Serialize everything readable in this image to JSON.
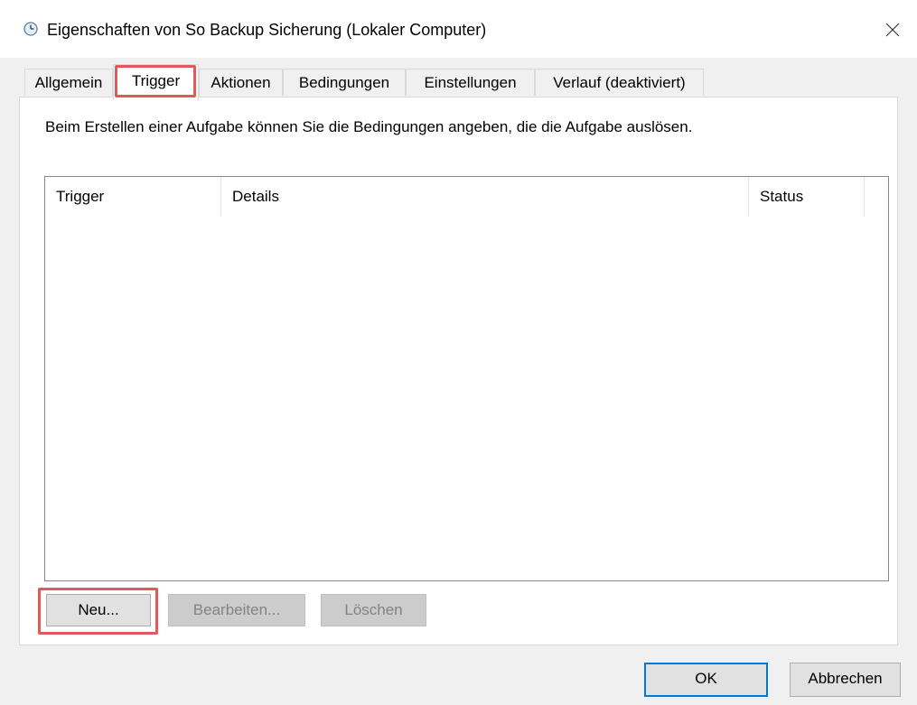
{
  "window": {
    "title": "Eigenschaften von So Backup Sicherung (Lokaler Computer)",
    "close_glyph": "✕",
    "icon": "clock-icon"
  },
  "tabs": [
    {
      "label": "Allgemein",
      "active": false
    },
    {
      "label": "Trigger",
      "active": true
    },
    {
      "label": "Aktionen",
      "active": false
    },
    {
      "label": "Bedingungen",
      "active": false
    },
    {
      "label": "Einstellungen",
      "active": false
    },
    {
      "label": "Verlauf (deaktiviert)",
      "active": false
    }
  ],
  "trigger_tab": {
    "description": "Beim Erstellen einer Aufgabe können Sie die Bedingungen angeben, die die Aufgabe auslösen.",
    "columns": [
      "Trigger",
      "Details",
      "Status"
    ],
    "rows": [],
    "buttons": {
      "new": "Neu...",
      "edit": "Bearbeiten...",
      "delete": "Löschen"
    }
  },
  "footer": {
    "ok": "OK",
    "cancel": "Abbrechen"
  },
  "colors": {
    "highlight": "#e05a5a",
    "focus_border": "#0078d7",
    "dialog_bg": "#f0f0f0"
  }
}
